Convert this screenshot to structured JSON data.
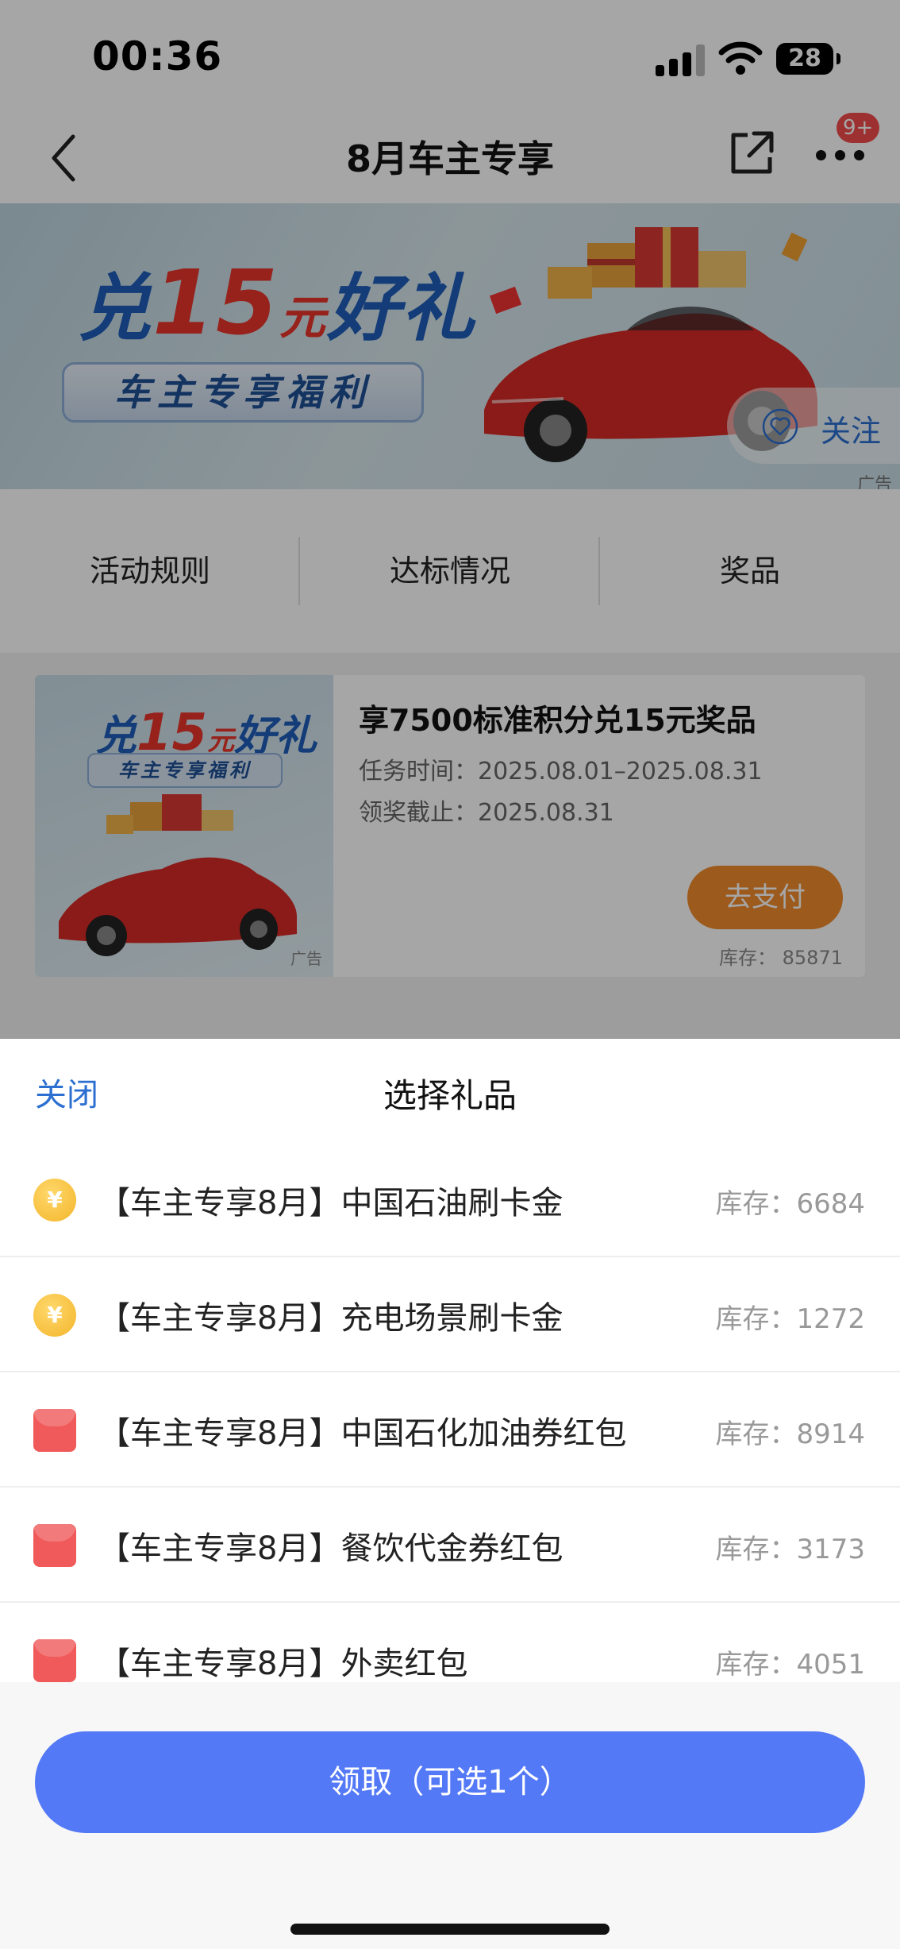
{
  "status_bar": {
    "time": "00:36",
    "battery": "28"
  },
  "nav": {
    "title": "8月车主专享",
    "badge": "9+"
  },
  "banner": {
    "title_prefix": "兑",
    "title_number": "15",
    "title_unit": "元",
    "title_suffix": "好礼",
    "subtitle": "车主专享福利",
    "follow_label": "关注",
    "ad_label": "广告"
  },
  "tabs": [
    {
      "label": "活动规则"
    },
    {
      "label": "达标情况"
    },
    {
      "label": "奖品"
    }
  ],
  "card": {
    "title": "享7500标准积分兑15元奖品",
    "task_time": "任务时间：2025.08.01–2025.08.31",
    "deadline": "领奖截止：2025.08.31",
    "pay_label": "去支付",
    "stock": "库存： 85871",
    "thumb_ad": "广告"
  },
  "sheet": {
    "close_label": "关闭",
    "title": "选择礼品",
    "items": [
      {
        "icon": "coin-icon",
        "name": "【车主专享8月】中国石油刷卡金",
        "stock": "库存：6684"
      },
      {
        "icon": "coin-icon",
        "name": "【车主专享8月】充电场景刷卡金",
        "stock": "库存：1272"
      },
      {
        "icon": "red-envelope-icon",
        "name": "【车主专享8月】中国石化加油券红包",
        "stock": "库存：8914"
      },
      {
        "icon": "red-envelope-icon",
        "name": "【车主专享8月】餐饮代金券红包",
        "stock": "库存：3173"
      },
      {
        "icon": "red-envelope-icon",
        "name": "【车主专享8月】外卖红包",
        "stock": "库存：4051"
      }
    ],
    "claim_label": "领取（可选1个）"
  },
  "colors": {
    "accent_blue": "#5479f7",
    "link_blue": "#2c6fd1",
    "pay_orange": "#f08a2c",
    "badge_red": "#f24c4c"
  }
}
